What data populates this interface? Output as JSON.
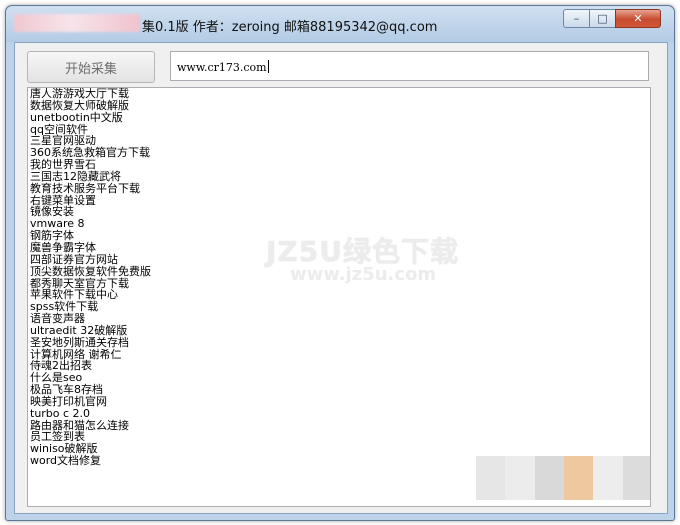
{
  "window": {
    "title": "集0.1版 作者：zeroing 邮箱88195342@qq.com",
    "controls": {
      "minimize": "–",
      "maximize": "□",
      "close": "✕"
    }
  },
  "toolbar": {
    "start_label": "开始采集",
    "url_value": "www.cr173.com"
  },
  "log": {
    "items": [
      "唐人游游戏大厅下载",
      "数据恢复大师破解版",
      "unetbootin中文版",
      "qq空间软件",
      "三星官网驱动",
      "360系统急救箱官方下载",
      "我的世界雪石",
      "三国志12隐藏武将",
      "教育技术服务平台下载",
      "右键菜单设置",
      "镜像安装",
      "vmware 8",
      "钢筋字体",
      "魔兽争霸字体",
      "四部证券官方网站",
      "顶尖数据恢复软件免费版",
      "都秀聊天室官方下载",
      "苹果软件下载中心",
      "spss软件下载",
      "语音变声器",
      "ultraedit 32破解版",
      "圣安地列斯通关存档",
      "计算机网络 谢希仁",
      "侍魂2出招表",
      "什么是seo",
      "极品飞车8存档",
      "映美打印机官网",
      "turbo c 2.0",
      "路由器和猫怎么连接",
      "员工签到表",
      "winiso破解版",
      "word文档修复"
    ]
  },
  "watermark": {
    "main": "JZ5U绿色下载",
    "sub": "www.jz5u.com"
  },
  "colors": {
    "frame": "#bcd3ea",
    "client": "#f0f0f0",
    "close": "#c74b2f"
  },
  "mosaic_colors": [
    "#e6e6e6",
    "#ececec",
    "#d9d9d9",
    "#f0c8a0",
    "#ededed",
    "#dcdcdc"
  ]
}
